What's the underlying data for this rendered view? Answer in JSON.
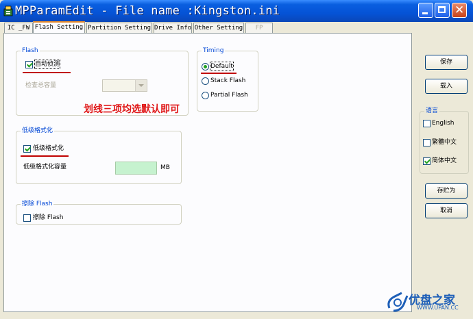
{
  "window": {
    "title": "MPParamEdit - File name :Kingston.ini"
  },
  "tabs": [
    {
      "label": "IC _FW"
    },
    {
      "label": "Flash Setting"
    },
    {
      "label": "Partition Setting"
    },
    {
      "label": "Drive Info"
    },
    {
      "label": "Other Setting"
    },
    {
      "label": "FP"
    }
  ],
  "flash_group": {
    "title": "Flash",
    "auto_detect": {
      "label": "自动侦测",
      "checked": true
    },
    "check_capacity": {
      "label": "检查总容量",
      "value": ""
    }
  },
  "timing_group": {
    "title": "Timing",
    "options": [
      {
        "label": "Default",
        "selected": true
      },
      {
        "label": "Stack Flash",
        "selected": false
      },
      {
        "label": "Partial Flash",
        "selected": false
      }
    ]
  },
  "annotation": "划线三项均选默认即可",
  "format_group": {
    "title": "低级格式化",
    "low_format": {
      "label": "低级格式化",
      "checked": true
    },
    "capacity": {
      "label": "低级格式化容量",
      "value": "",
      "unit": "MB"
    }
  },
  "erase_group": {
    "title": "擦除 Flash",
    "erase": {
      "label": "擦除 Flash",
      "checked": false
    }
  },
  "buttons": {
    "save": "保存",
    "load": "载入",
    "save_as": "存贮为",
    "cancel": "取消"
  },
  "language_group": {
    "title": "语言",
    "options": [
      {
        "label": "English",
        "checked": false
      },
      {
        "label": "繁體中文",
        "checked": false
      },
      {
        "label": "简体中文",
        "checked": true
      }
    ]
  },
  "watermark": {
    "brand": "优盘之家",
    "url": "WWW.UPAN.CC"
  },
  "colors": {
    "title_bar": "#0553d6",
    "group_label": "#0046d5",
    "annotation": "#e01818",
    "check_mark": "#21a121",
    "textbox_fill": "#c6f2cf"
  }
}
